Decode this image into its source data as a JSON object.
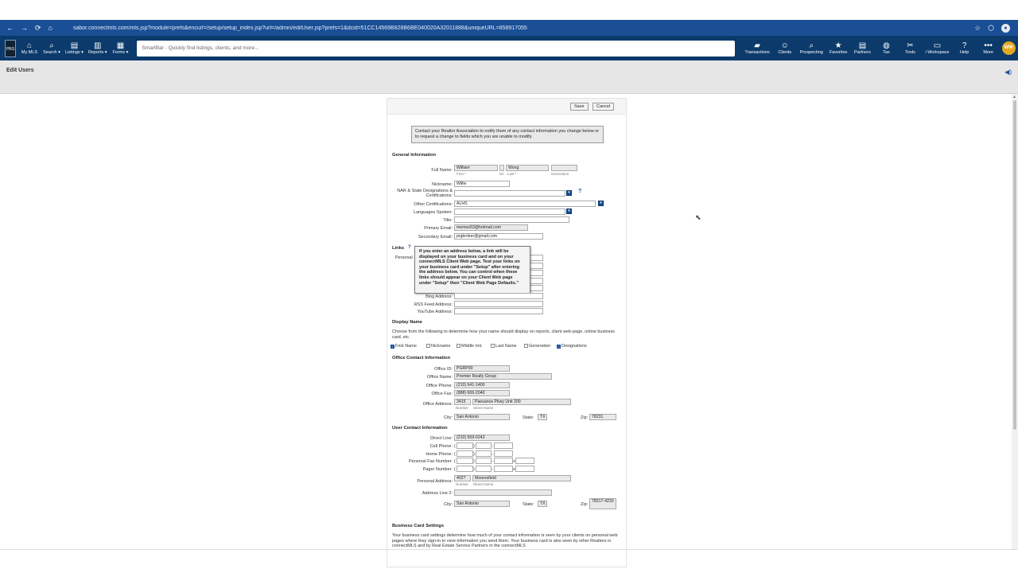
{
  "browser": {
    "url": "sabor.connectmls.com/mls.jsp?module=prefs&encurl=/setup/setup_index.jsp?url=/admin/editUser.jsp?prefs=1&dcid=51CC14569B828B6BE040020A32011888&uniqueURL=858917055",
    "icons": {
      "back": "←",
      "forward": "→",
      "reload": "⟳",
      "home": "⌂",
      "star": "☆",
      "ext": "⬡"
    }
  },
  "app": {
    "logo": "PRG",
    "left_nav": [
      {
        "label": "My MLS",
        "icon": "⌂"
      },
      {
        "label": "Search ▾",
        "icon": "⌕"
      },
      {
        "label": "Listings ▾",
        "icon": "▤"
      },
      {
        "label": "Reports ▾",
        "icon": "▥"
      },
      {
        "label": "Forms ▾",
        "icon": "▦"
      }
    ],
    "smartbar_placeholder": "SmartBar - Quickly find listings, clients, and more...",
    "right_nav": [
      {
        "label": "Transactions",
        "icon": "▰"
      },
      {
        "label": "Clients",
        "icon": "☺"
      },
      {
        "label": "Prospecting",
        "icon": "⌕"
      },
      {
        "label": "Favorites",
        "icon": "★"
      },
      {
        "label": "Partners",
        "icon": "▤"
      },
      {
        "label": "Tax",
        "icon": "◍"
      },
      {
        "label": "Tools",
        "icon": "✂"
      },
      {
        "label": "i Workspace",
        "icon": "▭"
      },
      {
        "label": "Help",
        "icon": "?"
      },
      {
        "label": "More",
        "icon": "•••"
      }
    ],
    "avatar": "WW"
  },
  "page": {
    "title": "Edit Users",
    "speaker_icon": "◀)"
  },
  "form": {
    "save": "Save",
    "cancel": "Cancel",
    "notice": "Contact your Realtor Association to notify them of any contact information you change below or to request a change to fields which you are unable to modify.",
    "general_title": "General Information",
    "full_name_label": "Full Name:",
    "first": "William",
    "mi": "",
    "last": "Wong",
    "generation": "",
    "first_sub": "First *",
    "mi_sub": "MI",
    "last_sub": "Last *",
    "gen_sub": "Generation",
    "nickname_label": "Nickname:",
    "nickname": "Willie",
    "nar_label": "NAR & State Designations & Certifications:",
    "nar": "",
    "other_cert_label": "Other Certifications:",
    "other_cert": "ALHS",
    "languages_label": "Languages Spoken:",
    "languages": "",
    "title_label": "Title:",
    "title_val": "",
    "primary_email_label": "Primary Email:",
    "primary_email": "memos53@hotmail.com",
    "secondary_email_label": "Secondary Email:",
    "secondary_email": "prgbroker@gmail.com",
    "links_title": "Links",
    "personal_label": "Personal",
    "tooltip": "If you enter an address below, a link will be displayed on your business card and on your connectMLS Client Web page. Test your links on your business card under \"Setup\" after entering the address below. You can control when these links should appear on your Client Web page under \"Setup\" then \"Client Web Page Defaults.\"",
    "blog_label": "Blog Address:",
    "rss_label": "RSS Feed Address:",
    "youtube_label": "YouTube Address:",
    "display_title": "Display Name",
    "display_desc": "Choose from the following to determine how your name should display on reports, client web-page, online business card, etc.",
    "checks": [
      {
        "label": "First Name",
        "on": true
      },
      {
        "label": "Nickname",
        "on": false
      },
      {
        "label": "Middle Init.",
        "on": false
      },
      {
        "label": "Last Name",
        "on": false
      },
      {
        "label": "Generation",
        "on": false
      },
      {
        "label": "Designations",
        "on": true
      }
    ],
    "office_title": "Office Contact Information",
    "office_id_label": "Office ID:",
    "office_id": "PGRP00",
    "office_name_label": "Office Name:",
    "office_name": "Premier Realty Group",
    "office_phone_label": "Office Phone:",
    "office_phone": "(210) 641-1400",
    "office_fax_label": "Office Fax:",
    "office_fax": "(888) 606-2040",
    "office_addr_label": "Office Address:",
    "office_num": "3415",
    "office_street": "Paesanos Pkwy Unit 200",
    "num_sub": "Number",
    "street_sub": "Street Name",
    "city_label": "City:",
    "office_city": "San Antonio",
    "state_label": "State:",
    "office_state": "TX",
    "zip_label": "Zip:",
    "office_zip": "78231",
    "user_title": "User Contact Information",
    "direct_label": "Direct Line:",
    "direct": "(210) 559-0243",
    "cell_label": "Cell Phone:",
    "home_label": "Home Phone:",
    "pfax_label": "Personal Fax Number:",
    "pager_label": "Pager Number:",
    "paren_open": "(",
    "paren_close": ")",
    "dash": "-",
    "ext_x": "x",
    "paddr_label": "Personal Address:",
    "p_num": "4027",
    "p_street": "Mooresfield",
    "addr2_label": "Address Line 2:",
    "addr2": "",
    "p_city": "San Antonio",
    "p_state": "TX",
    "p_zip": "78217-4233",
    "bc_title": "Business Card Settings",
    "bc_desc": "Your business card settings determine how much of your contact information is seen by your clients on personal web pages where they sign-in to view information you send them. Your business card is also seen by other Realtors in connectMLS and by Real Estate Service Partners in the connectMLS"
  }
}
